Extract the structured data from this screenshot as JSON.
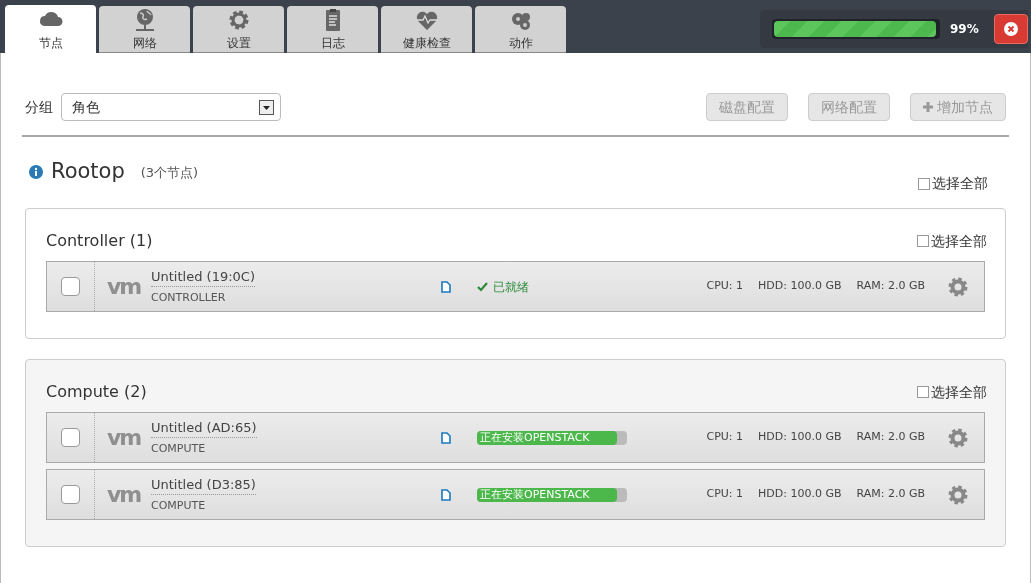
{
  "tabs": [
    {
      "label": "节点",
      "selected": true
    },
    {
      "label": "网络",
      "selected": false
    },
    {
      "label": "设置",
      "selected": false
    },
    {
      "label": "日志",
      "selected": false
    },
    {
      "label": "健康检查",
      "selected": false
    },
    {
      "label": "动作",
      "selected": false
    }
  ],
  "deployment": {
    "level": 0.99,
    "reading": "99%"
  },
  "toolbar": {
    "group_label": "分组",
    "group_value": "角色",
    "buttons": [
      {
        "label": "磁盘配置",
        "kind": "plain",
        "disabled": true
      },
      {
        "label": "网络配置",
        "kind": "plain",
        "disabled": true
      },
      {
        "label": "增加节点",
        "kind": "add",
        "disabled": true
      }
    ]
  },
  "environment": {
    "name": "Rootop",
    "count": "(3个节点)",
    "select_all": {
      "label": "选择全部",
      "checked": false
    }
  },
  "groups": [
    {
      "title": "Controller (1)",
      "select_all": {
        "label": "选择全部",
        "checked": false
      },
      "nodes": [
        {
          "name": "Untitled (19:0C)",
          "role": "CONTROLLER",
          "logo": "vm",
          "checked": false,
          "status": {
            "kind": "ready",
            "label": "已就绪"
          },
          "cpu": "CPU: 1",
          "hdd": "HDD: 100.0 GB",
          "ram": "RAM: 2.0 GB"
        }
      ]
    },
    {
      "title": "Compute (2)",
      "select_all": {
        "label": "选择全部",
        "checked": false
      },
      "nodes": [
        {
          "name": "Untitled (AD:65)",
          "role": "COMPUTE",
          "logo": "vm",
          "checked": false,
          "status": {
            "kind": "installing",
            "label": "正在安装OPENSTACK",
            "level": 0.93
          },
          "cpu": "CPU: 1",
          "hdd": "HDD: 100.0 GB",
          "ram": "RAM: 2.0 GB"
        },
        {
          "name": "Untitled (D3:85)",
          "role": "COMPUTE",
          "logo": "vm",
          "checked": false,
          "status": {
            "kind": "installing",
            "label": "正在安装OPENSTACK",
            "level": 0.93
          },
          "cpu": "CPU: 1",
          "hdd": "HDD: 100.0 GB",
          "ram": "RAM: 2.0 GB"
        }
      ]
    }
  ]
}
